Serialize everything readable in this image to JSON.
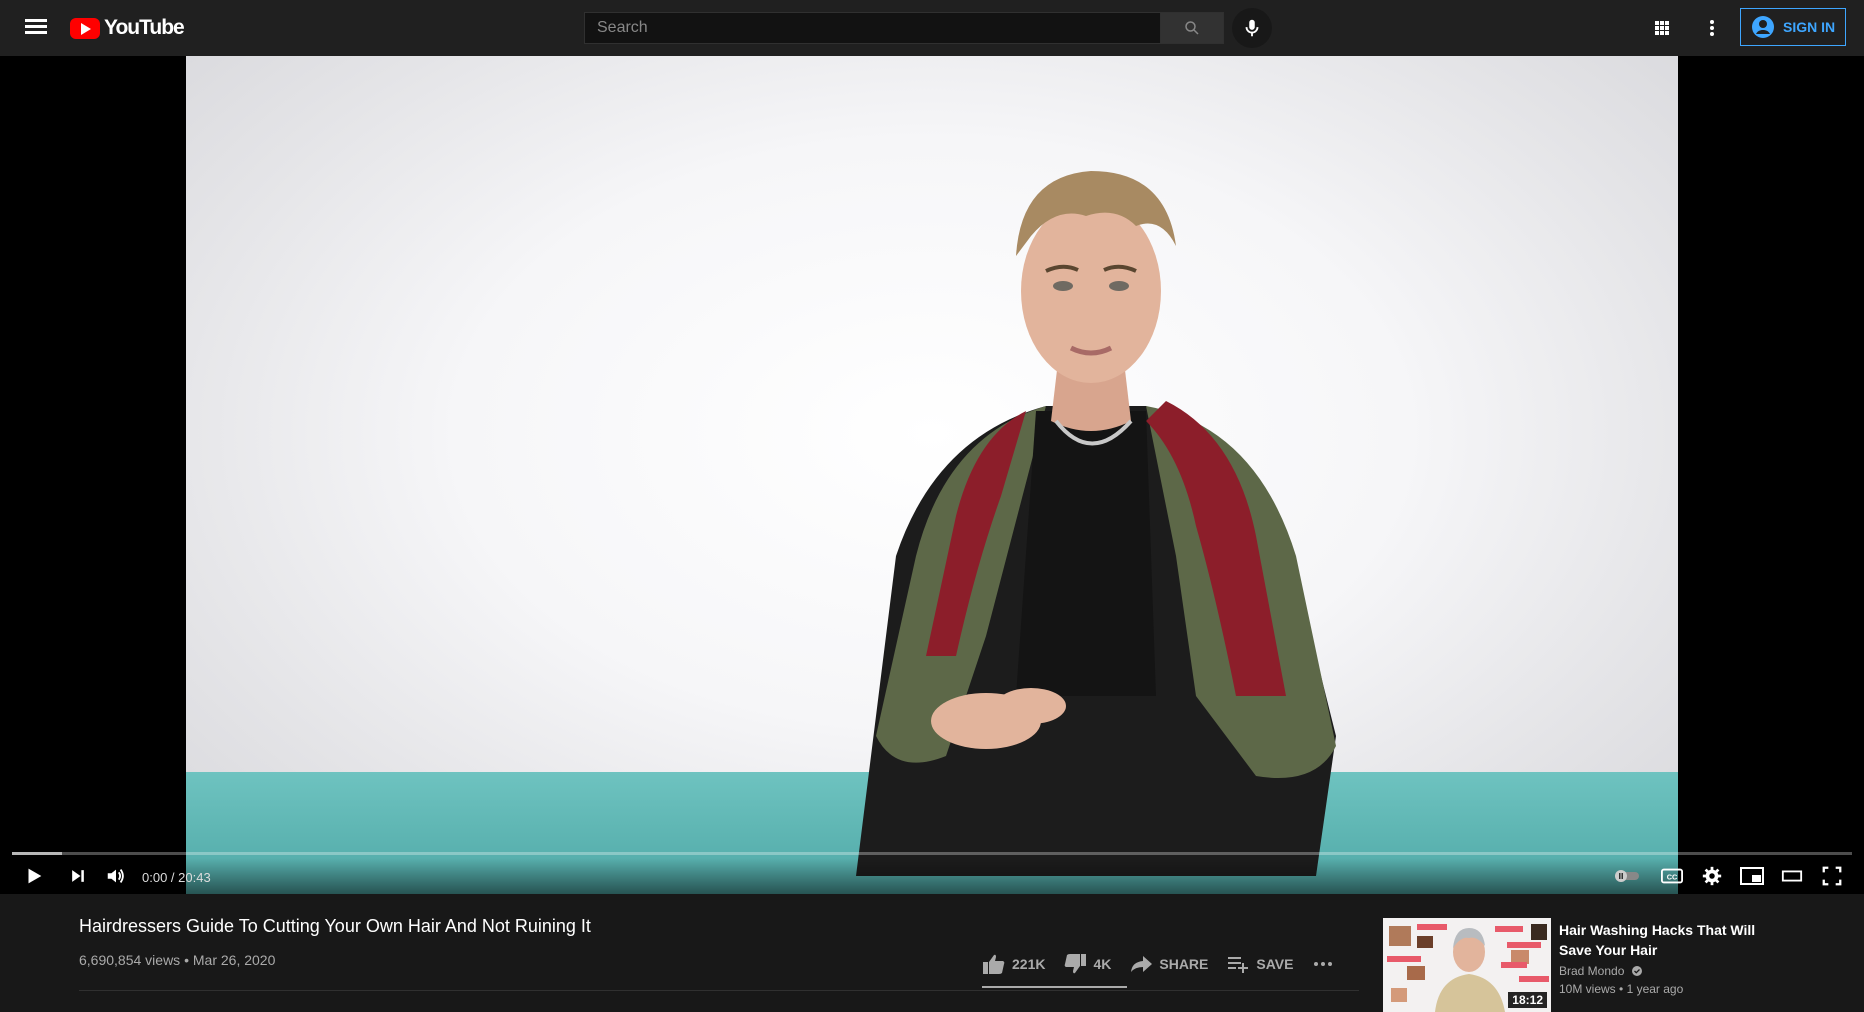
{
  "header": {
    "logo_text": "YouTube",
    "search_placeholder": "Search",
    "signin_label": "SIGN IN"
  },
  "player": {
    "time_current": "0:00",
    "time_separator": " / ",
    "time_total": "20:43",
    "progress_fraction": 0.027
  },
  "video": {
    "title": "Hairdressers Guide To Cutting Your Own Hair And Not Ruining It",
    "views": "6,690,854 views",
    "date_separator": " • ",
    "date": "Mar 26, 2020",
    "likes": "221K",
    "dislikes": "4K",
    "share_label": "SHARE",
    "save_label": "SAVE"
  },
  "recommended": [
    {
      "title": "Hair Washing Hacks That Will Save Your Hair",
      "channel": "Brad Mondo",
      "views": "10M views",
      "meta_separator": " • ",
      "age": "1 year ago",
      "duration": "18:12"
    }
  ],
  "colors": {
    "accent_blue": "#3ea6ff",
    "youtube_red": "#ff0000",
    "bg_dark": "#181818",
    "topbar": "#202020"
  }
}
